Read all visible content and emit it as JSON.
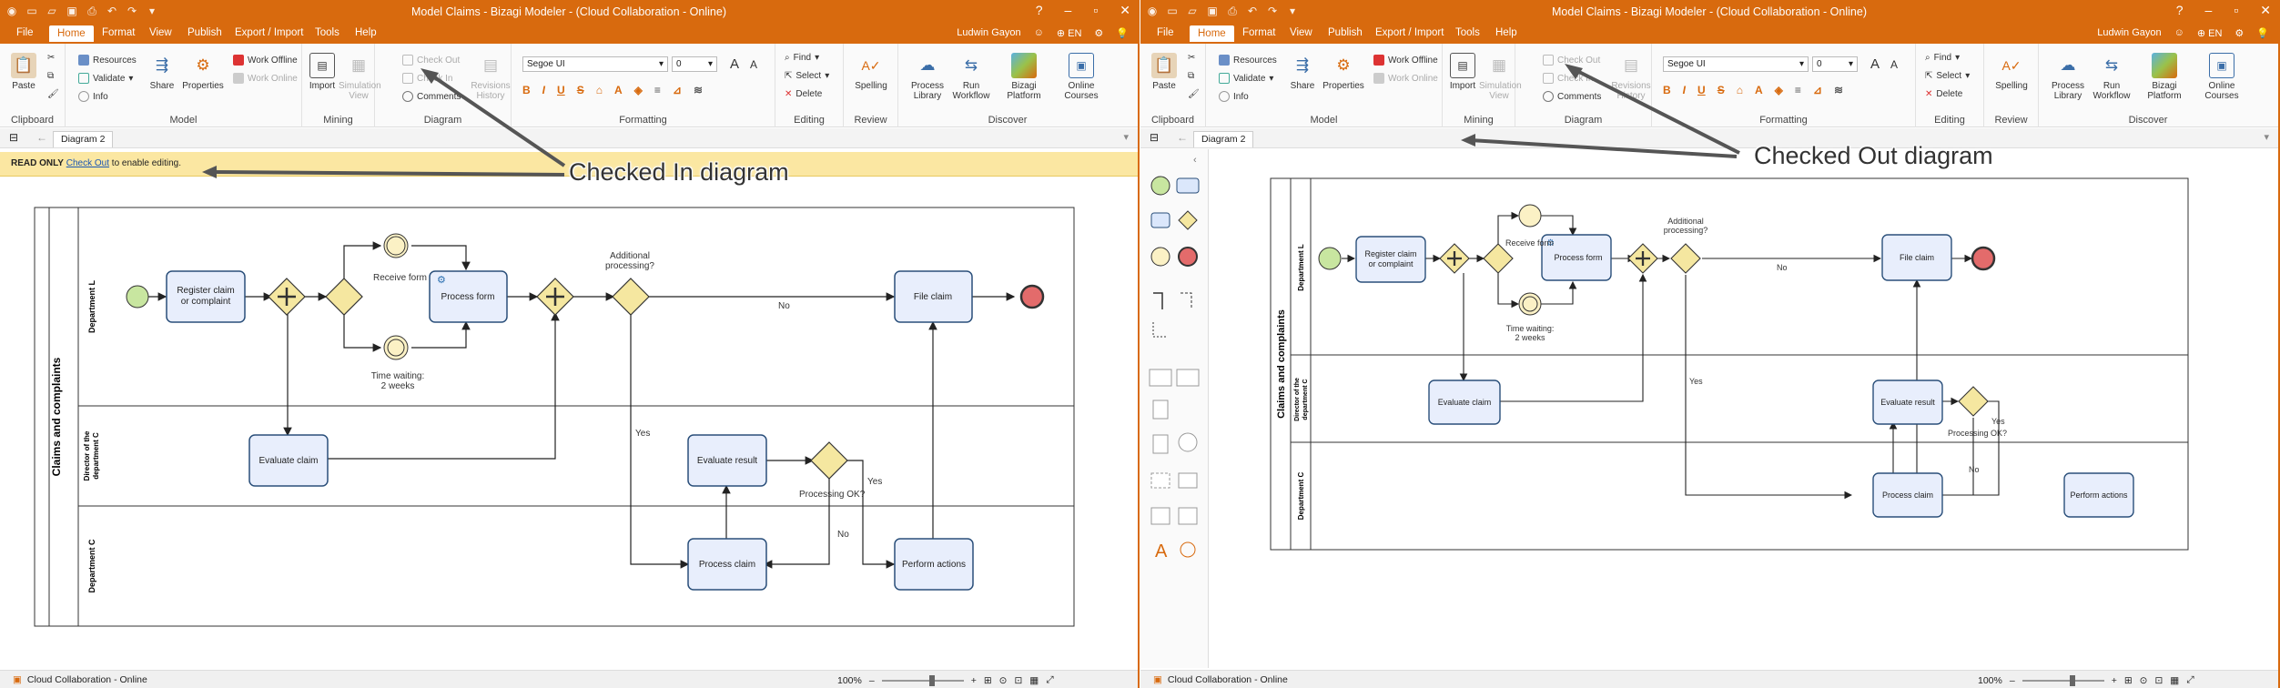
{
  "app": {
    "title": "Model Claims - Bizagi Modeler - (Cloud Collaboration - Online)",
    "user": "Ludwin Gayon",
    "language": "EN",
    "accent_color": "#d86a0e"
  },
  "menu": {
    "tabs": [
      "File",
      "Home",
      "Format",
      "View",
      "Publish",
      "Export / Import",
      "Tools",
      "Help"
    ],
    "active": "Home"
  },
  "ribbon": {
    "clipboard": {
      "label": "Clipboard",
      "paste": "Paste"
    },
    "model": {
      "label": "Model",
      "resources": "Resources",
      "validate": "Validate",
      "info": "Info",
      "share": "Share",
      "properties": "Properties",
      "work_offline": "Work Offline",
      "work_online": "Work Online"
    },
    "mining": {
      "label": "Mining",
      "import": "Import",
      "simulation_view": "Simulation View"
    },
    "diagram": {
      "label": "Diagram",
      "check_out": "Check Out",
      "check_in": "Check In",
      "comments": "Comments",
      "revisions_history": "Revisions History"
    },
    "formatting": {
      "label": "Formatting",
      "font": "Segoe UI",
      "size": "0"
    },
    "editing": {
      "label": "Editing",
      "find": "Find",
      "select": "Select",
      "delete": "Delete"
    },
    "review": {
      "label": "Review",
      "spelling": "Spelling"
    },
    "discover": {
      "label": "Discover",
      "process_library": "Process Library",
      "run_workflow": "Run Workflow",
      "bizagi_platform": "Bizagi Platform",
      "online_courses": "Online Courses"
    }
  },
  "document": {
    "tab": "Diagram 2"
  },
  "readonly_bar": {
    "label": "READ ONLY",
    "link": "Check Out",
    "rest": "to enable editing."
  },
  "callouts": {
    "left": "Checked In diagram",
    "right": "Checked Out diagram"
  },
  "diagram": {
    "pool": "Claims and complaints",
    "lanes": [
      "Department L",
      "Director of the department C",
      "Department C"
    ],
    "tasks": {
      "register": "Register claim or complaint",
      "process_form": "Process form",
      "file_claim": "File claim",
      "evaluate_claim": "Evaluate claim",
      "evaluate_result": "Evaluate result",
      "process_claim": "Process claim",
      "perform_actions": "Perform actions"
    },
    "labels": {
      "receive_form": "Receive form",
      "time_waiting": "Time waiting: 2 weeks",
      "additional_processing": "Additional processing?",
      "processing_ok": "Processing OK?",
      "no": "No",
      "yes": "Yes"
    }
  },
  "statusbar": {
    "left": "Cloud Collaboration - Online",
    "zoom": "100%"
  }
}
